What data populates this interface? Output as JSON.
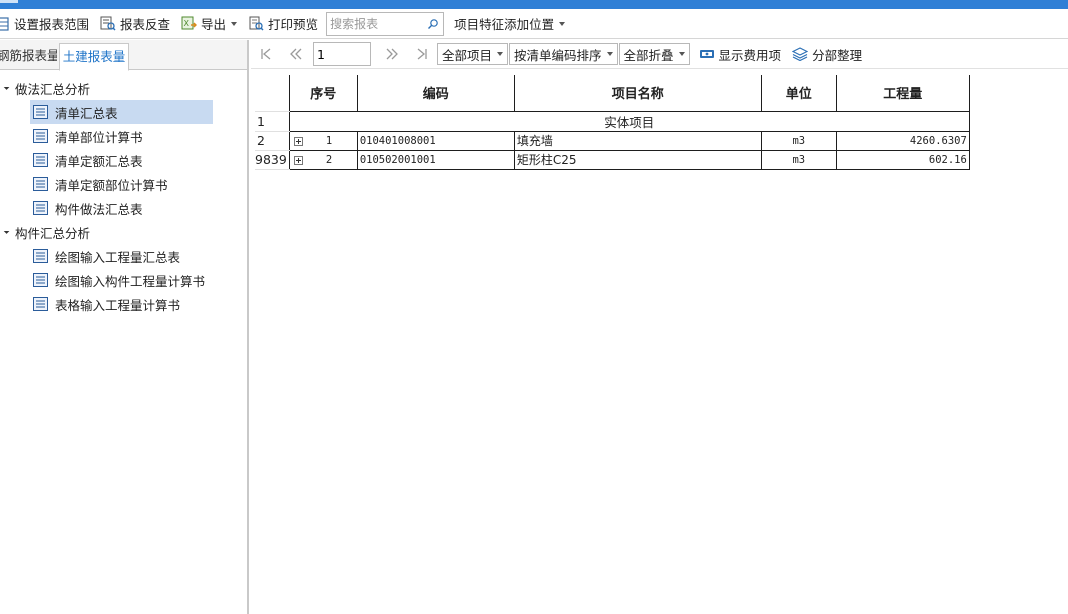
{
  "toolbar": {
    "set_range": "设置报表范围",
    "check": "报表反查",
    "export": "导出",
    "print_preview": "打印预览",
    "search_placeholder": "搜索报表",
    "feature_position": "项目特征添加位置"
  },
  "left_tabs": {
    "tab1": "钢筋报表量",
    "tab2": "土建报表量"
  },
  "tree": {
    "group1": {
      "label": "做法汇总分析",
      "items": [
        "清单汇总表",
        "清单部位计算书",
        "清单定额汇总表",
        "清单定额部位计算书",
        "构件做法汇总表"
      ]
    },
    "group2": {
      "label": "构件汇总分析",
      "items": [
        "绘图输入工程量汇总表",
        "绘图输入构件工程量计算书",
        "表格输入工程量计算书"
      ]
    }
  },
  "nav": {
    "page_value": "1",
    "all_items": "全部项目",
    "sort": "按清单编码排序",
    "fold": "全部折叠",
    "show_fee": "显示费用项",
    "arrange": "分部整理"
  },
  "grid": {
    "headers": [
      "序号",
      "编码",
      "项目名称",
      "单位",
      "工程量"
    ],
    "section_row": {
      "row_num": "1",
      "title": "实体项目"
    },
    "rows": [
      {
        "row_num": "2",
        "seq": "1",
        "code": "010401008001",
        "name": "填充墙",
        "unit": "m3",
        "qty": "4260.6307"
      },
      {
        "row_num": "9839",
        "seq": "2",
        "code": "010502001001",
        "name": "矩形柱C25",
        "unit": "m3",
        "qty": "602.16"
      }
    ]
  },
  "colors": {
    "titlebar": "#2f7fd6",
    "selected_item": "#c8daf1",
    "active_tab_text": "#1f74c8"
  }
}
